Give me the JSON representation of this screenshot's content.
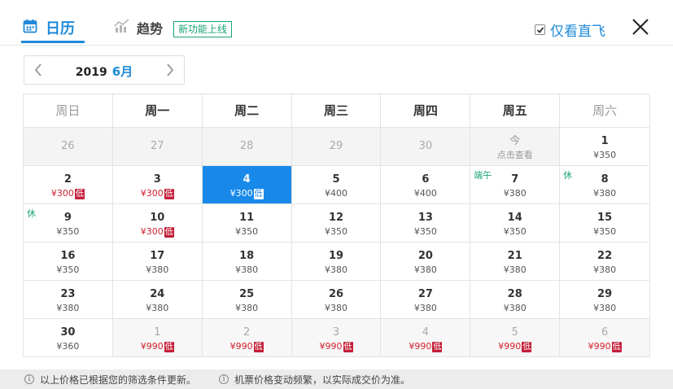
{
  "tabs": {
    "calendar_label": "日历",
    "trend_label": "趋势",
    "new_badge": "新功能上线"
  },
  "direct_only": {
    "label": "仅看直飞",
    "checked": true
  },
  "month_nav": {
    "year": "2019",
    "month": "6月"
  },
  "weekdays": [
    "周日",
    "周一",
    "周二",
    "周三",
    "周四",
    "周五",
    "周六"
  ],
  "weeks": [
    [
      {
        "day": "26",
        "price": "",
        "state": "past"
      },
      {
        "day": "27",
        "price": "",
        "state": "past"
      },
      {
        "day": "28",
        "price": "",
        "state": "past"
      },
      {
        "day": "29",
        "price": "",
        "state": "past"
      },
      {
        "day": "30",
        "price": "",
        "state": "past"
      },
      {
        "day": "今",
        "price": "点击查看",
        "state": "today"
      },
      {
        "day": "1",
        "price": "¥350",
        "state": ""
      }
    ],
    [
      {
        "day": "2",
        "price": "¥300",
        "state": "low",
        "tag": "低"
      },
      {
        "day": "3",
        "price": "¥300",
        "state": "low",
        "tag": "低"
      },
      {
        "day": "4",
        "price": "¥300",
        "state": "selected",
        "tag": "低"
      },
      {
        "day": "5",
        "price": "¥400",
        "state": ""
      },
      {
        "day": "6",
        "price": "¥400",
        "state": ""
      },
      {
        "day": "7",
        "price": "¥380",
        "state": "",
        "holiday": "端午"
      },
      {
        "day": "8",
        "price": "¥380",
        "state": "",
        "rest": "休"
      }
    ],
    [
      {
        "day": "9",
        "price": "¥350",
        "state": "",
        "rest": "休"
      },
      {
        "day": "10",
        "price": "¥300",
        "state": "low",
        "tag": "低"
      },
      {
        "day": "11",
        "price": "¥350",
        "state": ""
      },
      {
        "day": "12",
        "price": "¥350",
        "state": ""
      },
      {
        "day": "13",
        "price": "¥350",
        "state": ""
      },
      {
        "day": "14",
        "price": "¥350",
        "state": ""
      },
      {
        "day": "15",
        "price": "¥350",
        "state": ""
      }
    ],
    [
      {
        "day": "16",
        "price": "¥350",
        "state": ""
      },
      {
        "day": "17",
        "price": "¥380",
        "state": ""
      },
      {
        "day": "18",
        "price": "¥380",
        "state": ""
      },
      {
        "day": "19",
        "price": "¥380",
        "state": ""
      },
      {
        "day": "20",
        "price": "¥380",
        "state": ""
      },
      {
        "day": "21",
        "price": "¥380",
        "state": ""
      },
      {
        "day": "22",
        "price": "¥380",
        "state": ""
      }
    ],
    [
      {
        "day": "23",
        "price": "¥380",
        "state": ""
      },
      {
        "day": "24",
        "price": "¥380",
        "state": ""
      },
      {
        "day": "25",
        "price": "¥380",
        "state": ""
      },
      {
        "day": "26",
        "price": "¥380",
        "state": ""
      },
      {
        "day": "27",
        "price": "¥380",
        "state": ""
      },
      {
        "day": "28",
        "price": "¥380",
        "state": ""
      },
      {
        "day": "29",
        "price": "¥380",
        "state": ""
      }
    ],
    [
      {
        "day": "30",
        "price": "¥360",
        "state": ""
      },
      {
        "day": "1",
        "price": "¥990",
        "state": "next low",
        "tag": "低"
      },
      {
        "day": "2",
        "price": "¥990",
        "state": "next low",
        "tag": "低"
      },
      {
        "day": "3",
        "price": "¥990",
        "state": "next low",
        "tag": "低"
      },
      {
        "day": "4",
        "price": "¥990",
        "state": "next low",
        "tag": "低"
      },
      {
        "day": "5",
        "price": "¥990",
        "state": "next low",
        "tag": "低"
      },
      {
        "day": "6",
        "price": "¥990",
        "state": "next low",
        "tag": "低"
      }
    ]
  ],
  "footer": {
    "notice_1": "以上价格已根据您的筛选条件更新。",
    "notice_2": "机票价格变动频繁，以实际成交价为准。"
  },
  "colors": {
    "accent": "#1f8ad9",
    "selected": "#1889e9",
    "low_price": "#d0212e",
    "holiday": "#1aa37a"
  },
  "icons": {
    "calendar": "calendar-icon",
    "trend": "trend-chart-icon",
    "close": "close-icon",
    "prev": "chevron-left-icon",
    "next": "chevron-right-icon",
    "info": "info-icon"
  }
}
